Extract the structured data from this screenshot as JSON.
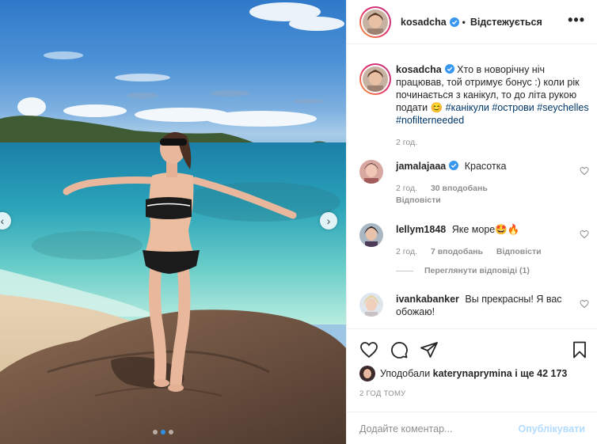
{
  "post": {
    "username": "kosadcha",
    "follow_state": "Відстежується",
    "more_icon": "•••"
  },
  "caption": {
    "username": "kosadcha",
    "text": "Хто в новорічну ніч працював, той отримує бонус :) коли рік починається з канікул, то до літа рукою подати",
    "emoji": "😊",
    "hashtags": [
      "#канікули",
      "#острови",
      "#seychelles",
      "#nofilterneeded"
    ],
    "time": "2 год."
  },
  "comments": [
    {
      "username": "jamalajaaa",
      "verified": true,
      "text": "Красотка",
      "time": "2 год.",
      "likes": "30 вподобань",
      "reply": "Відповісти"
    },
    {
      "username": "lellym1848",
      "verified": false,
      "text": "Яке море🤩🔥",
      "time": "2 год.",
      "likes": "7 вподобань",
      "reply": "Відповісти",
      "view_replies": "Переглянути відповіді (1)"
    },
    {
      "username": "ivankabanker",
      "verified": false,
      "text": "Вы прекрасны! Я вас обожаю!"
    }
  ],
  "likes": {
    "prefix": "Уподобали",
    "user": "katerynaprymina",
    "suffix": "і ще 42 173"
  },
  "time_ago": "2 ГОД ТОМУ",
  "comment_box": {
    "placeholder": "Додайте коментар...",
    "publish": "Опублікувати"
  },
  "carousel": {
    "prev": "‹",
    "next": "›",
    "slide_count": 3,
    "active_slide": 2
  },
  "colors": {
    "verified_blue": "#3897f0",
    "hashtag": "#00376b",
    "muted": "#8e8e8e",
    "publish_disabled": "#b3dbff"
  }
}
